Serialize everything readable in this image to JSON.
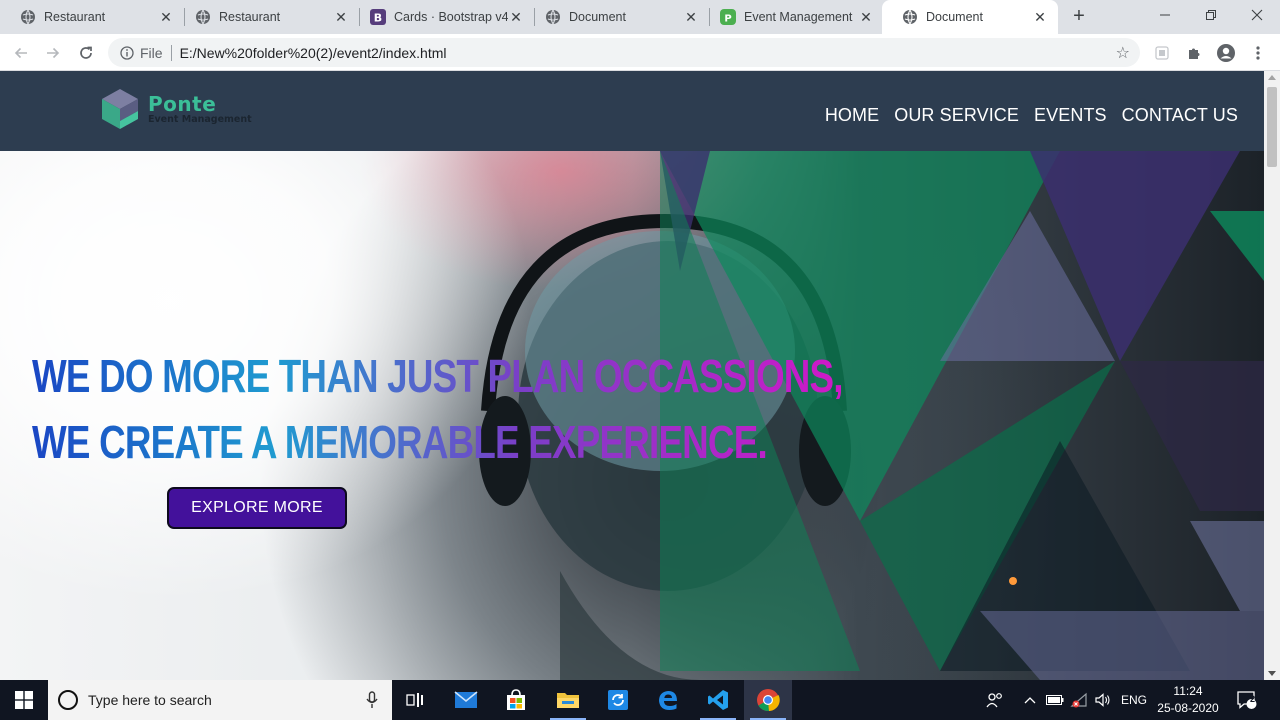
{
  "browser": {
    "tabs": [
      {
        "title": "Restaurant",
        "icon": "globe-icon",
        "active": false
      },
      {
        "title": "Restaurant",
        "icon": "globe-icon",
        "active": false
      },
      {
        "title": "Cards · Bootstrap v4.",
        "icon": "bootstrap-icon",
        "active": false
      },
      {
        "title": "Document",
        "icon": "globe-icon",
        "active": false
      },
      {
        "title": "Event Management",
        "icon": "p-icon",
        "active": false
      },
      {
        "title": "Document",
        "icon": "globe-icon",
        "active": true
      }
    ],
    "address": {
      "scheme_label": "File",
      "url": "E:/New%20folder%20(2)/event2/index.html"
    }
  },
  "site": {
    "logo": {
      "name": "Ponte",
      "tagline": "Event Management"
    },
    "nav": [
      "HOME",
      "OUR SERVICE",
      "EVENTS",
      "CONTACT US"
    ],
    "hero": {
      "line1": "WE DO MORE THAN JUST PLAN OCCASSIONS,",
      "line2": "WE CREATE A MEMORABLE EXPERIENCE.",
      "cta": "EXPLORE MORE"
    }
  },
  "taskbar": {
    "search_placeholder": "Type here to search",
    "language": "ENG",
    "time": "11:24",
    "date": "25-08-2020",
    "notifications": "2"
  },
  "colors": {
    "header_bg": "#2d3d50",
    "brand_green": "#3bbf98",
    "cta_bg": "#43119b",
    "tri_green": "#0d8a5c",
    "tri_purple": "#3b2f6e"
  }
}
